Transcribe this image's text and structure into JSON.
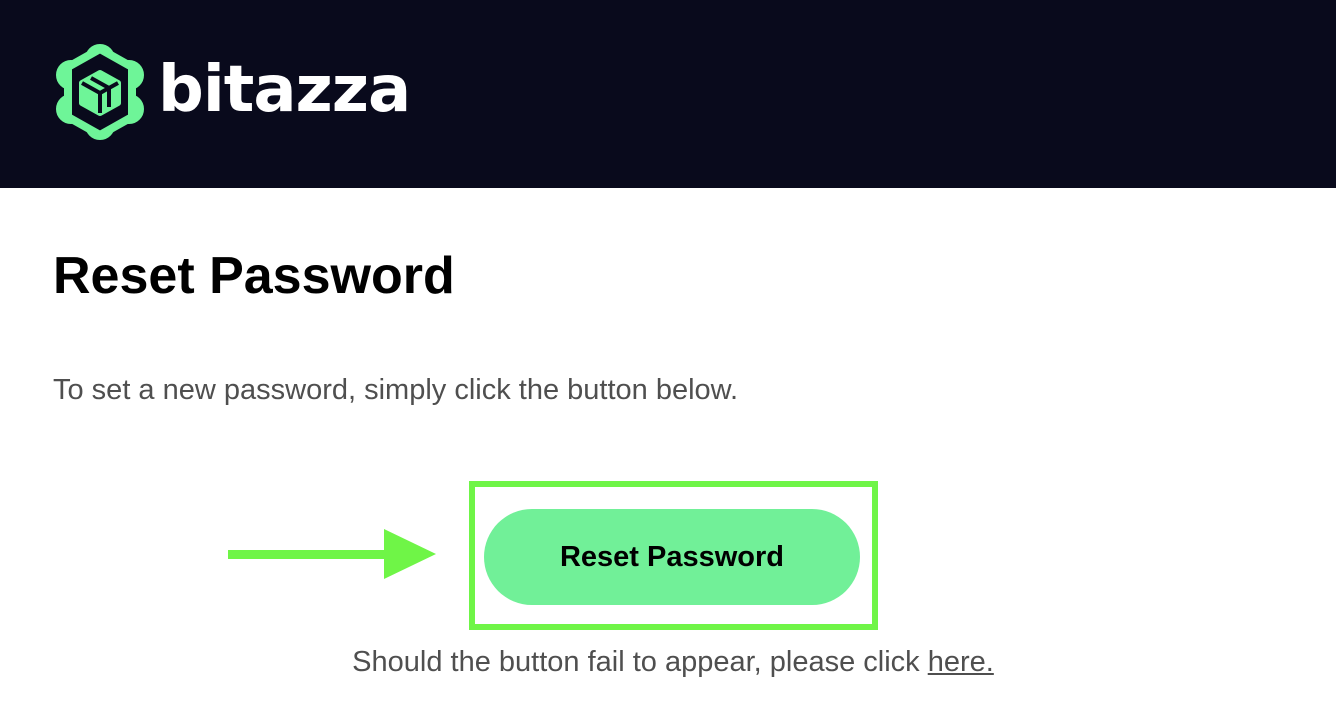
{
  "brand": {
    "name": "bitazza",
    "logo_icon": "bitazza-logo-icon",
    "logo_color": "#6ef598",
    "header_bg": "#090a1c"
  },
  "content": {
    "title": "Reset Password",
    "intro": "To set a new password, simply click the button below.",
    "reset_button_label": "Reset Password",
    "fallback_text": "Should the button fail to appear, please click",
    "fallback_link": "here."
  },
  "annotation": {
    "arrow_icon": "arrow-right-icon",
    "highlight_color": "#6ff547"
  },
  "colors": {
    "button_bg": "#71f098",
    "body_text": "#4f4f4f",
    "title_text": "#000000"
  }
}
